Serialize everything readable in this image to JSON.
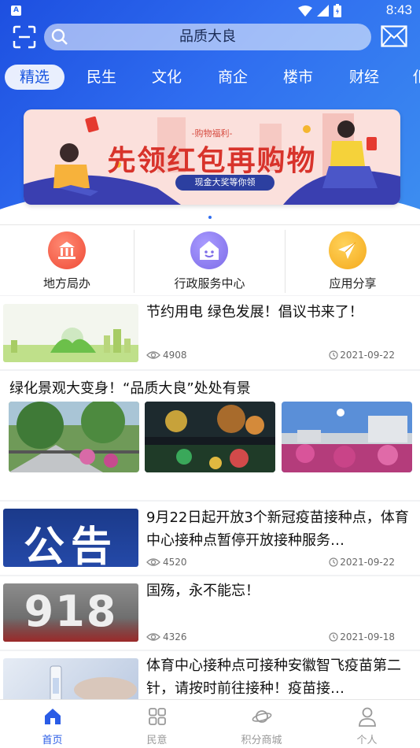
{
  "status_bar": {
    "time": "8:43"
  },
  "search": {
    "placeholder": "品质大良"
  },
  "tabs": [
    {
      "label": "精选",
      "active": true
    },
    {
      "label": "民生"
    },
    {
      "label": "文化"
    },
    {
      "label": "商企"
    },
    {
      "label": "楼市"
    },
    {
      "label": "财经"
    },
    {
      "label": "佢"
    }
  ],
  "banner": {
    "subtitle": "-购物福利-",
    "title": "先领红包再购物",
    "pill": "现金大奖等你领"
  },
  "quick_links": [
    {
      "label": "地方局办",
      "color": "#f05a45",
      "icon": "bank-icon"
    },
    {
      "label": "行政服务中心",
      "color": "#8c7cf2",
      "icon": "service-icon"
    },
    {
      "label": "应用分享",
      "color": "#f7b524",
      "icon": "paper-plane-icon"
    }
  ],
  "news": [
    {
      "title": "节约用电 绿色发展！倡议书来了！",
      "views": "4908",
      "date": "2021-09-22"
    },
    {
      "title": "9月22日起开放3个新冠疫苗接种点，体育中心接种点暂停开放接种服务…",
      "views": "4520",
      "date": "2021-09-22",
      "thumb_text": "公告"
    },
    {
      "title": "国殇，永不能忘！",
      "views": "4326",
      "date": "2021-09-18",
      "thumb_text": "918"
    },
    {
      "title": "体育中心接种点可接种安徽智飞疫苗第二针，请按时前往接种！疫苗接…"
    }
  ],
  "gallery": {
    "title": "绿化景观大变身！“品质大良”处处有景"
  },
  "bottom_nav": [
    {
      "label": "首页",
      "active": true
    },
    {
      "label": "民意"
    },
    {
      "label": "积分商城"
    },
    {
      "label": "个人"
    }
  ]
}
